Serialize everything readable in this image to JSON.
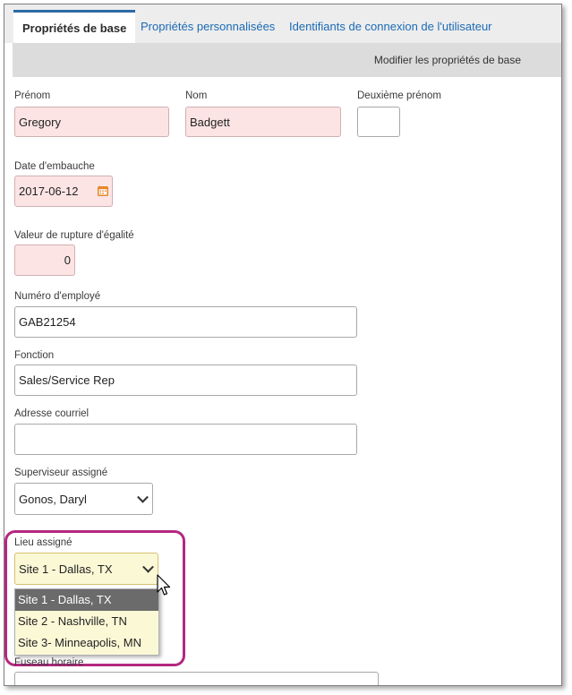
{
  "tabs": [
    {
      "label": "Propriétés de base"
    },
    {
      "label": "Propriétés personnalisées"
    },
    {
      "label": "Identifiants de connexion de l'utilisateur"
    }
  ],
  "subheader": "Modifier les propriétés de base",
  "fields": {
    "first_name": {
      "label": "Prénom",
      "value": "Gregory"
    },
    "last_name": {
      "label": "Nom",
      "value": "Badgett"
    },
    "middle_name": {
      "label": "Deuxième prénom",
      "value": ""
    },
    "hire_date": {
      "label": "Date d'embauche",
      "value": "2017-06-12"
    },
    "tiebreak": {
      "label": "Valeur de rupture d'égalité",
      "value": "0"
    },
    "employee_number": {
      "label": "Numéro d'employé",
      "value": "GAB21254"
    },
    "job_title": {
      "label": "Fonction",
      "value": "Sales/Service Rep"
    },
    "email": {
      "label": "Adresse courriel",
      "value": ""
    },
    "supervisor": {
      "label": "Superviseur assigné",
      "value": "Gonos, Daryl"
    },
    "location": {
      "label": "Lieu assigné",
      "value": "Site 1 - Dallas, TX",
      "options": [
        "Site 1 - Dallas, TX",
        "Site 2 - Nashville, TN",
        "Site 3- Minneapolis, MN"
      ]
    },
    "timezone": {
      "label": "Fuseau horaire"
    }
  },
  "colors": {
    "tab_accent": "#2c6aa5",
    "required_bg": "#fde4e4",
    "dropdown_bg": "#fbf8d6",
    "highlight_border": "#b4277f",
    "calendar_icon": "#e8862a"
  },
  "icons": [
    "calendar-icon",
    "chevron-down-icon",
    "mouse-cursor-icon"
  ]
}
